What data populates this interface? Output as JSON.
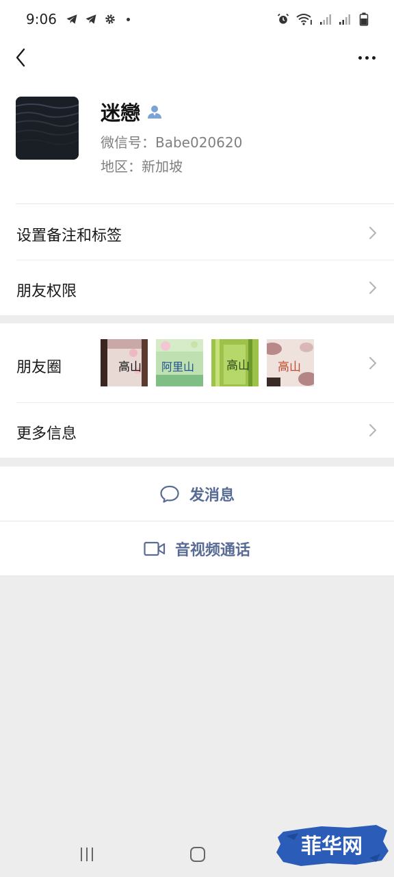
{
  "status_bar": {
    "time": "9:06",
    "left_icons": [
      "telegram-icon",
      "telegram-icon",
      "gear-icon"
    ],
    "right_icons": [
      "alarm-icon",
      "wifi-icon",
      "signal-icon",
      "signal-icon",
      "battery-icon"
    ]
  },
  "nav": {
    "back_icon": "chevron-left-icon",
    "more_icon": "more-icon"
  },
  "profile": {
    "name": "迷戀",
    "badge_icon": "person-icon",
    "wechat_id": "微信号：Babe020620",
    "region": "地区：新加坡"
  },
  "menu": {
    "remark_tags": "设置备注和标签",
    "friend_permissions": "朋友权限",
    "moments": "朋友圈",
    "more_info": "更多信息"
  },
  "moments_thumbnails": [
    {
      "caption": "高山"
    },
    {
      "caption": "阿里山"
    },
    {
      "caption": "高山"
    },
    {
      "caption": "高山"
    }
  ],
  "actions": {
    "send_message": "发消息",
    "video_call": "音视频通话"
  },
  "watermark": {
    "text": "菲华网"
  },
  "colors": {
    "link_blue": "#576b95",
    "background": "#ededed",
    "watermark_blue": "#2b5db8"
  }
}
